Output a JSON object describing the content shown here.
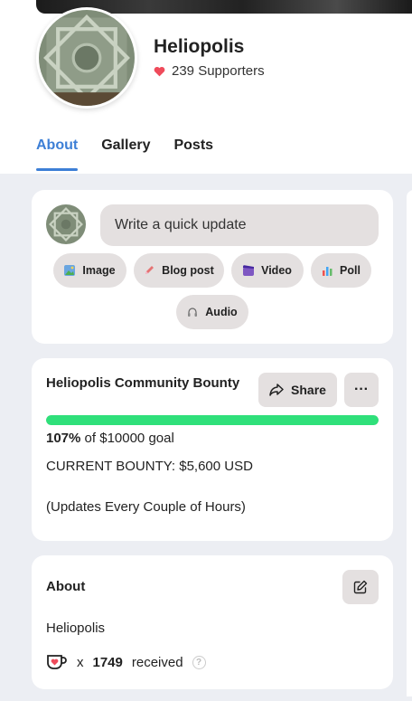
{
  "profile": {
    "name": "Heliopolis",
    "supporters_text": "239 Supporters"
  },
  "tabs": [
    {
      "label": "About",
      "active": true
    },
    {
      "label": "Gallery",
      "active": false
    },
    {
      "label": "Posts",
      "active": false
    }
  ],
  "composer": {
    "placeholder": "Write a quick update",
    "buttons": [
      {
        "label": "Image",
        "icon": "image-icon"
      },
      {
        "label": "Blog post",
        "icon": "pen-icon"
      },
      {
        "label": "Video",
        "icon": "video-icon"
      },
      {
        "label": "Poll",
        "icon": "poll-icon"
      },
      {
        "label": "Audio",
        "icon": "headphones-icon"
      }
    ]
  },
  "bounty": {
    "title": "Heliopolis Community Bounty",
    "share_label": "Share",
    "more_label": "···",
    "progress_fraction": 1.0,
    "percent_text": "107%",
    "goal_text": "of $10000 goal",
    "current_text": "CURRENT BOUNTY: $5,600 USD",
    "updates_text": "(Updates Every Couple of Hours)"
  },
  "about": {
    "title": "About",
    "text": "Heliopolis",
    "received_x": "x",
    "received_count": "1749",
    "received_label": "received",
    "help_label": "?"
  },
  "colors": {
    "accent": "#3d7fd6",
    "progress": "#2fe07a",
    "button_bg": "#e4e0e0",
    "heart": "#ef4b5b",
    "page_bg": "#eceef3"
  }
}
